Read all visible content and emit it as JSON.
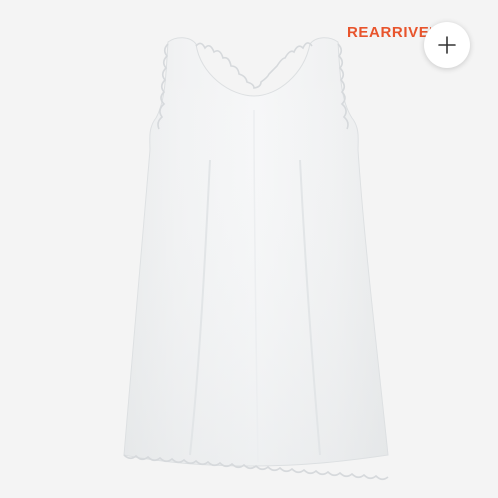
{
  "product_card": {
    "badge_text": "REARRIVED",
    "badge_color": "#e8542c",
    "add_button_icon": "plus-icon",
    "background_color": "#f4f4f4"
  }
}
